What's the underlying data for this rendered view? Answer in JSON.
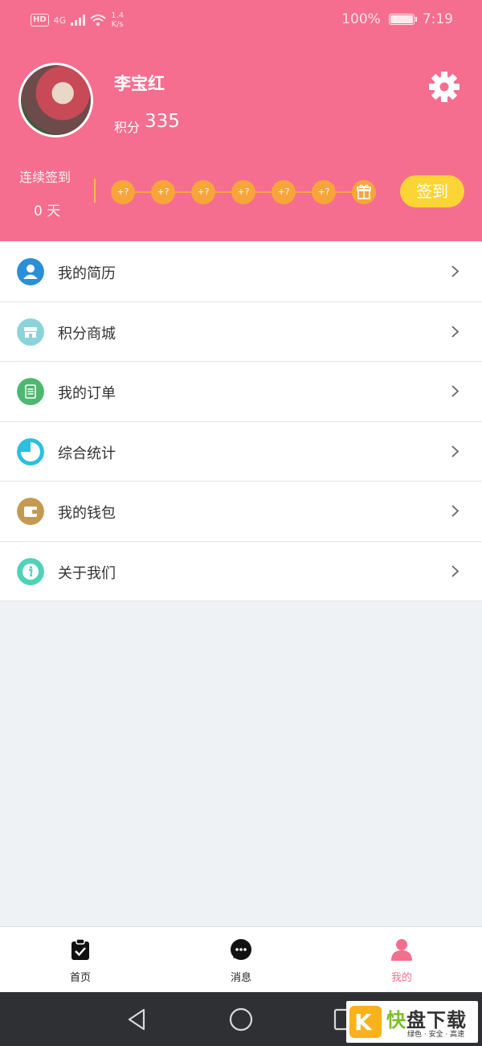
{
  "status_bar": {
    "network": "HD",
    "signal": "4G",
    "speed_value": "1.4",
    "speed_unit": "K/s",
    "battery": "100%",
    "time": "7:19"
  },
  "profile": {
    "name": "李宝红",
    "points_label": "积分",
    "points_value": "335"
  },
  "signin": {
    "streak_label": "连续签到",
    "streak_days": "0 天",
    "rewards": [
      "+?",
      "+?",
      "+?",
      "+?",
      "+?",
      "+?"
    ],
    "button_label": "签到"
  },
  "menu": [
    {
      "label": "我的简历",
      "icon": "user-icon",
      "color": "#2a8fd6"
    },
    {
      "label": "积分商城",
      "icon": "store-icon",
      "color": "#8ad3d9"
    },
    {
      "label": "我的订单",
      "icon": "order-icon",
      "color": "#4db870"
    },
    {
      "label": "综合统计",
      "icon": "pie-chart-icon",
      "color": "#2bbfe0"
    },
    {
      "label": "我的钱包",
      "icon": "wallet-icon",
      "color": "#c49a52"
    },
    {
      "label": "关于我们",
      "icon": "info-icon",
      "color": "#4fd2b7"
    }
  ],
  "tabs": [
    {
      "label": "首页",
      "icon": "clipboard-icon"
    },
    {
      "label": "消息",
      "icon": "message-icon"
    },
    {
      "label": "我的",
      "icon": "person-icon",
      "active": true
    }
  ],
  "watermark": {
    "k": "K",
    "kuai": "快",
    "rest": "盘下载",
    "subtitle": "绿色 · 安全 · 高速"
  },
  "colors": {
    "header": "#f56e8f",
    "signin_button": "#fbd535",
    "reward_dot": "#f7a53a",
    "active_tab": "#f26f8e"
  }
}
